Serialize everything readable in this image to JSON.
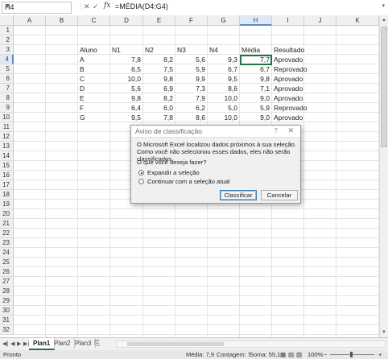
{
  "formula_bar": {
    "name_box": "H4",
    "fx": "fx",
    "formula": "=MÉDIA(D4:G4)"
  },
  "columns": [
    "A",
    "B",
    "C",
    "D",
    "E",
    "F",
    "G",
    "H",
    "I",
    "J",
    "K"
  ],
  "rows": [
    "1",
    "2",
    "3",
    "4",
    "5",
    "6",
    "7",
    "8",
    "9",
    "10",
    "11",
    "12",
    "13",
    "14",
    "15",
    "16",
    "17",
    "18",
    "19",
    "20",
    "21",
    "22",
    "23",
    "24",
    "25",
    "26",
    "27",
    "28",
    "29",
    "30",
    "31",
    "32"
  ],
  "table": {
    "headers": [
      "Aluno",
      "N1",
      "N2",
      "N3",
      "N4",
      "Média",
      "Resultado"
    ],
    "rows": [
      [
        "A",
        "7,8",
        "8,2",
        "5,6",
        "9,3",
        "7,7",
        "Aprovado"
      ],
      [
        "B",
        "6,5",
        "7,5",
        "5,9",
        "6,7",
        "6,7",
        "Reprovado"
      ],
      [
        "C",
        "10,0",
        "9,8",
        "9,9",
        "9,5",
        "9,8",
        "Aprovado"
      ],
      [
        "D",
        "5,6",
        "6,9",
        "7,3",
        "8,6",
        "7,1",
        "Aprovado"
      ],
      [
        "E",
        "9,8",
        "8,2",
        "7,9",
        "10,0",
        "9,0",
        "Aprovado"
      ],
      [
        "F",
        "6,4",
        "6,0",
        "6,2",
        "5,0",
        "5,9",
        "Reprovado"
      ],
      [
        "G",
        "9,5",
        "7,8",
        "8,6",
        "10,0",
        "9,0",
        "Aprovado"
      ]
    ]
  },
  "dialog": {
    "title": "Aviso de classificação",
    "help": "?",
    "close": "✕",
    "message": "O Microsoft Excel localizou dados próximos à sua seleção. Como você não selecionou esses dados, eles não serão classificados.",
    "question": "O que você deseja fazer?",
    "options": [
      "Expandir a seleção",
      "Continuar com a seleção atual"
    ],
    "selected_option": "Expandir a seleção",
    "buttons": {
      "ok": "Classificar",
      "cancel": "Cancelar"
    }
  },
  "sheets": [
    "Plan1",
    "Plan2",
    "Plan3"
  ],
  "active_sheet": "Plan1",
  "status": {
    "mode": "Pronto",
    "average": "Média: 7,9",
    "count": "Contagem: 7",
    "sum": "Soma: 55,1",
    "zoom": "100%"
  },
  "colors": {
    "selection": "#217346",
    "header_active": "#e1e8f2",
    "grid": "#e3e3e3"
  }
}
